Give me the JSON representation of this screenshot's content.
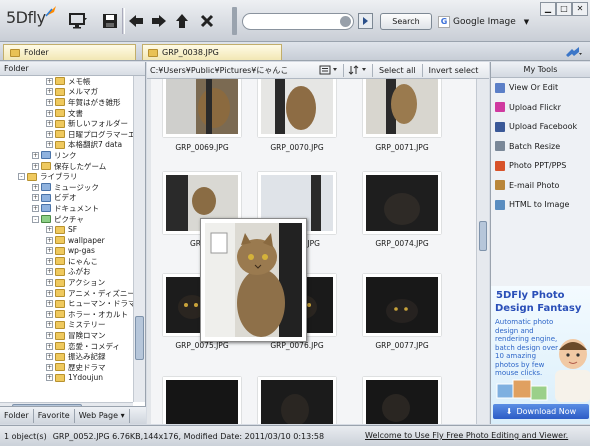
{
  "app": {
    "logo": "5Dfly"
  },
  "toolbar": {
    "search_button": "Search",
    "search_engine": "Google Image",
    "search_value": ""
  },
  "tabs": {
    "folder_tab": "Folder",
    "file_tab": "GRP_0038.JPG"
  },
  "left_panel": {
    "header": "Folder",
    "tree": [
      {
        "label": "メモ帳",
        "indent": 3,
        "exp": "+",
        "icon": "folder"
      },
      {
        "label": "メルマガ",
        "indent": 3,
        "exp": "+",
        "icon": "folder"
      },
      {
        "label": "年賀はがき雑形",
        "indent": 3,
        "exp": "+",
        "icon": "folder"
      },
      {
        "label": "文書",
        "indent": 3,
        "exp": "+",
        "icon": "folder"
      },
      {
        "label": "新しいフォルダー",
        "indent": 3,
        "exp": "+",
        "icon": "folder"
      },
      {
        "label": "日曜プログラマーエ",
        "indent": 3,
        "exp": "+",
        "icon": "folder"
      },
      {
        "label": "本格翻訳7 data",
        "indent": 3,
        "exp": "+",
        "icon": "folder"
      },
      {
        "label": "リンク",
        "indent": 2,
        "exp": "+",
        "icon": "blue"
      },
      {
        "label": "保存したゲーム",
        "indent": 2,
        "exp": "+",
        "icon": "folder"
      },
      {
        "label": "ライブラリ",
        "indent": 1,
        "exp": "-",
        "icon": "folder"
      },
      {
        "label": "ミュージック",
        "indent": 2,
        "exp": "+",
        "icon": "blue"
      },
      {
        "label": "ビデオ",
        "indent": 2,
        "exp": "+",
        "icon": "blue"
      },
      {
        "label": "ドキュメント",
        "indent": 2,
        "exp": "+",
        "icon": "blue"
      },
      {
        "label": "ピクチャ",
        "indent": 2,
        "exp": "-",
        "icon": "green"
      },
      {
        "label": "SF",
        "indent": 3,
        "exp": "+",
        "icon": "folder"
      },
      {
        "label": "wallpaper",
        "indent": 3,
        "exp": "+",
        "icon": "folder"
      },
      {
        "label": "wp-gas",
        "indent": 3,
        "exp": "+",
        "icon": "folder"
      },
      {
        "label": "にゃんこ",
        "indent": 3,
        "exp": "+",
        "icon": "folder"
      },
      {
        "label": "ふがお",
        "indent": 3,
        "exp": "+",
        "icon": "folder"
      },
      {
        "label": "アクション",
        "indent": 3,
        "exp": "+",
        "icon": "folder"
      },
      {
        "label": "アニメ・ディズニー",
        "indent": 3,
        "exp": "+",
        "icon": "folder"
      },
      {
        "label": "ヒューマン・ドラマ",
        "indent": 3,
        "exp": "+",
        "icon": "folder"
      },
      {
        "label": "ホラー・オカルト",
        "indent": 3,
        "exp": "+",
        "icon": "folder"
      },
      {
        "label": "ミステリー",
        "indent": 3,
        "exp": "+",
        "icon": "folder"
      },
      {
        "label": "冒険ロマン",
        "indent": 3,
        "exp": "+",
        "icon": "folder"
      },
      {
        "label": "恋愛・コメディ",
        "indent": 3,
        "exp": "+",
        "icon": "folder"
      },
      {
        "label": "振込み記録",
        "indent": 3,
        "exp": "+",
        "icon": "folder"
      },
      {
        "label": "歴史ドラマ",
        "indent": 3,
        "exp": "+",
        "icon": "folder"
      },
      {
        "label": "1Ydoujun",
        "indent": 3,
        "exp": "+",
        "icon": "folder"
      }
    ],
    "bottom_tabs": [
      "Folder",
      "Favorite",
      "Web Page ▾"
    ]
  },
  "center": {
    "path": "C:¥Users¥Public¥Pictures¥にゃんこ",
    "select_all": "Select all",
    "invert_select": "Invert select",
    "captions": [
      "GRP_0069.JPG",
      "GRP_0070.JPG",
      "GRP_0071.JPG",
      "GRP_0",
      "73.JPG",
      "GRP_0074.JPG",
      "GRP_0075.JPG",
      "GRP_0076.JPG",
      "GRP_0077.JPG"
    ]
  },
  "right_panel": {
    "header": "My Tools",
    "tools": [
      {
        "label": "View Or Edit",
        "icon": "view-edit-icon",
        "color": "#5b7fc7"
      },
      {
        "label": "Upload Flickr",
        "icon": "flickr-icon",
        "color": "#d03aa0"
      },
      {
        "label": "Upload Facebook",
        "icon": "facebook-icon",
        "color": "#3b5998"
      },
      {
        "label": "Batch Resize",
        "icon": "batch-resize-icon",
        "color": "#7a8898"
      },
      {
        "label": "Photo PPT/PPS",
        "icon": "ppt-icon",
        "color": "#d8532a"
      },
      {
        "label": "E-mail Photo",
        "icon": "email-icon",
        "color": "#b9863a"
      },
      {
        "label": "HTML to Image",
        "icon": "html-image-icon",
        "color": "#5a8dc0"
      }
    ],
    "ad": {
      "title1": "5DFly Photo",
      "title2": "Design Fantasy",
      "text": "Automatic photo design and rendering engine, batch design over 10 amazing photos by few mouse clicks.",
      "download": "Download Now"
    }
  },
  "status": {
    "count": "1 object(s)",
    "info": "GRP_0052.JPG  6.76KB,144x176, Modified Date: 2011/03/10 0:13:58",
    "link": "Welcome to Use Fly Free Photo Editing and Viewer."
  }
}
